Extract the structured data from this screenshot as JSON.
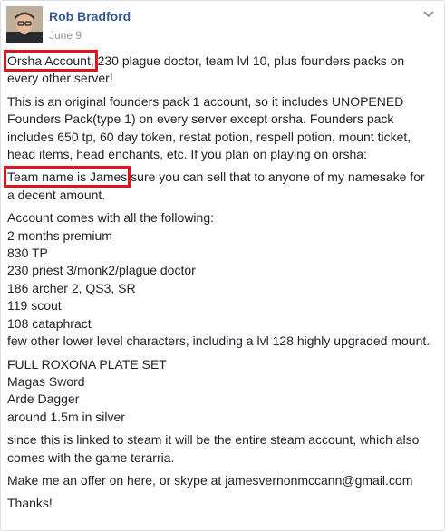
{
  "post": {
    "author": "Rob Bradford",
    "date": "June 9",
    "options_icon": "chevron-down-icon",
    "highlight_color": "#e0141c",
    "paragraphs": [
      {
        "highlight": "Orsha Account,",
        "rest": " 230 plague doctor, team lvl 10, plus founders packs on every other server!"
      },
      {
        "text": "This is an original founders pack 1 account, so it includes UNOPENED Founders Pack(type 1) on every server except orsha. Founders pack includes 650 tp, 60 day token, restat potion, respell potion, mount ticket, head items, head enchants, etc. If you plan on playing on orsha:"
      },
      {
        "highlight": "Team name is James",
        "rest": " sure you can sell that to anyone of my namesake for a decent amount."
      },
      {
        "lines": [
          "Account comes with all the following:",
          "2 months premium",
          "830 TP",
          "230 priest 3/monk2/plague doctor",
          "186 archer 2, QS3, SR",
          "119 scout",
          "108 cataphract",
          "few other lower level characters, including a lvl 128 highly upgraded mount."
        ]
      },
      {
        "lines": [
          "FULL ROXONA PLATE SET",
          "Magas Sword",
          "Arde Dagger",
          "around 1.5m in silver"
        ]
      },
      {
        "text": "since this is linked to steam it will be the entire steam account, which also comes with the game terarria."
      },
      {
        "text": "Make me an offer on here, or skype at jamesvernonmccann@gmail.com"
      },
      {
        "text": "Thanks!"
      }
    ]
  }
}
